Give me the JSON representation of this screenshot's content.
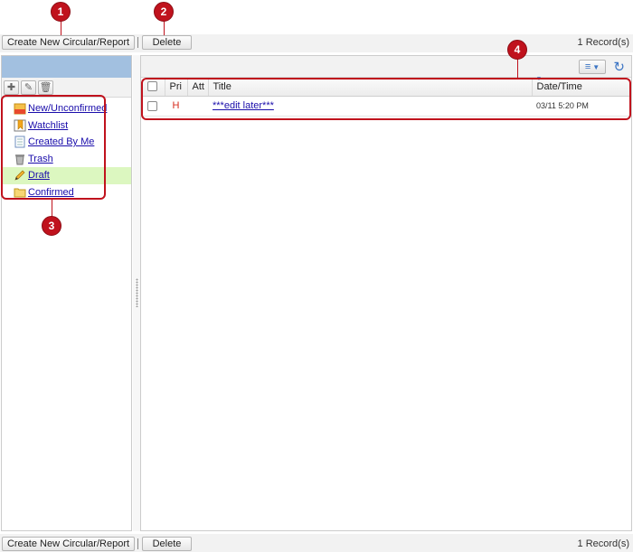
{
  "toolbar": {
    "create_label": "Create New Circular/Report",
    "delete_label": "Delete",
    "records": "1 Record(s)"
  },
  "folders": [
    {
      "label": "New/Unconfirmed",
      "icon": "new-folder-icon"
    },
    {
      "label": "Watchlist",
      "icon": "watchlist-icon"
    },
    {
      "label": "Created By Me",
      "icon": "document-icon"
    },
    {
      "label": "Trash",
      "icon": "trash-icon"
    },
    {
      "label": "Draft",
      "icon": "pencil-icon"
    },
    {
      "label": "Confirmed",
      "icon": "folder-icon"
    }
  ],
  "active_folder": "Draft",
  "table": {
    "headers": {
      "pri": "Pri",
      "att": "Att",
      "title": "Title",
      "datetime": "Date/Time"
    },
    "rows": [
      {
        "pri": "H",
        "att": "",
        "title": "***edit later***",
        "datetime": "03/11 5:20 PM"
      }
    ]
  },
  "callouts": [
    "1",
    "2",
    "3",
    "4"
  ],
  "colors": {
    "callout": "#c0121d",
    "left_header": "#a2c0e0",
    "active_folder_bg": "#dcf7c0",
    "link": "#1a0dab",
    "priority_high": "#d62b1c"
  }
}
